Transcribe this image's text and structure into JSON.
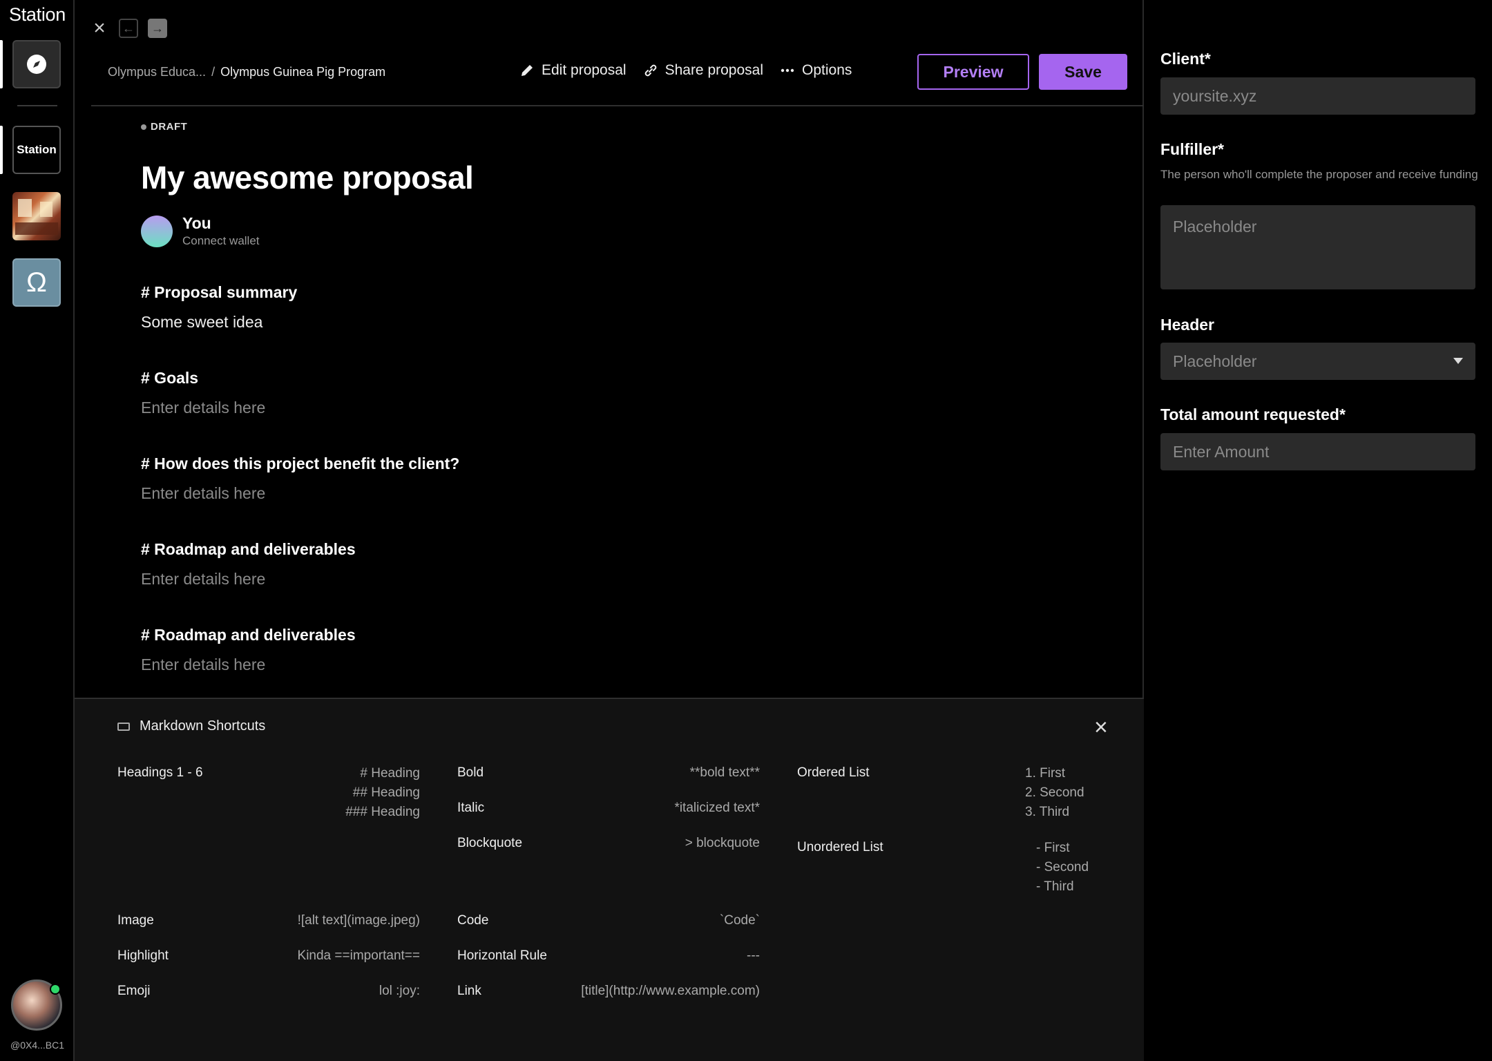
{
  "rail": {
    "brand": "Station",
    "station_label": "Station",
    "omega_label": "Ω",
    "address": "@0X4...BC1"
  },
  "nav": {
    "close_glyph": "×",
    "back_glyph": "←",
    "forward_glyph": "→"
  },
  "toolbar": {
    "crumb_parent": "Olympus Educa...",
    "crumb_sep": "/",
    "crumb_current": "Olympus Guinea Pig Program",
    "edit_label": "Edit proposal",
    "share_label": "Share proposal",
    "options_label": "Options",
    "preview_label": "Preview",
    "save_label": "Save"
  },
  "proposal": {
    "status": "DRAFT",
    "title": "My awesome proposal",
    "author_name": "You",
    "author_sub": "Connect wallet",
    "sections": [
      {
        "heading": "# Proposal summary",
        "body": "Some sweet idea"
      },
      {
        "heading": "# Goals",
        "body": "Enter details here"
      },
      {
        "heading": "# How does this project benefit the client?",
        "body": "Enter details here"
      },
      {
        "heading": "# Roadmap and deliverables",
        "body": "Enter details here"
      },
      {
        "heading": "# Roadmap and deliverables",
        "body": "Enter details here"
      }
    ]
  },
  "shortcuts": {
    "title": "Markdown Shortcuts",
    "close_glyph": "×",
    "headings_label": "Headings 1 - 6",
    "headings_values": [
      "# Heading",
      "## Heading",
      "### Heading"
    ],
    "bold_label": "Bold",
    "bold_value": "**bold text**",
    "italic_label": "Italic",
    "italic_value": "*italicized text*",
    "blockquote_label": "Blockquote",
    "blockquote_value": "> blockquote",
    "ordered_label": "Ordered List",
    "ordered_values": [
      "1. First",
      "2. Second",
      "3. Third"
    ],
    "unordered_label": "Unordered List",
    "unordered_values": [
      "- First",
      "- Second",
      "- Third"
    ],
    "image_label": "Image",
    "image_value": "![alt text](image.jpeg)",
    "code_label": "Code",
    "code_value": "`Code`",
    "highlight_label": "Highlight",
    "highlight_value": "Kinda ==important==",
    "hr_label": "Horizontal Rule",
    "hr_value": "---",
    "emoji_label": "Emoji",
    "emoji_value": "lol :joy:",
    "link_label": "Link",
    "link_value": "[title](http://www.example.com)"
  },
  "side": {
    "client_label": "Client*",
    "client_placeholder": "yoursite.xyz",
    "fulfiller_label": "Fulfiller*",
    "fulfiller_help": "The person who'll complete the proposer and receive funding",
    "fulfiller_placeholder": "Placeholder",
    "header_label": "Header",
    "header_value": "Placeholder",
    "amount_label": "Total amount requested*",
    "amount_placeholder": "Enter Amount"
  },
  "colors": {
    "accent": "#a565ef",
    "online": "#2fd86a"
  }
}
